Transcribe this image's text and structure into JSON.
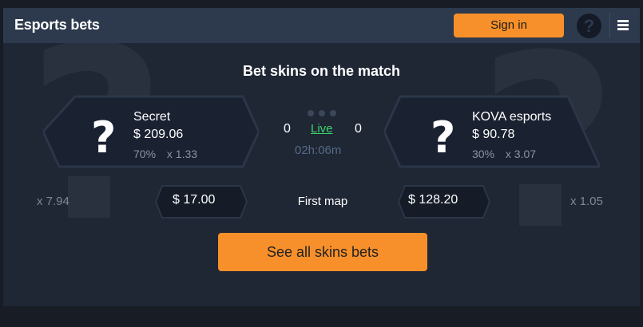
{
  "header": {
    "title": "Esports bets",
    "sign_in_label": "Sign in",
    "help_icon": "question-circle-icon",
    "menu_icon": "hamburger-menu-icon"
  },
  "headline": "Bet skins on the match",
  "match": {
    "team1": {
      "name": "Secret",
      "amount": "$ 209.06",
      "percent": "70%",
      "odds": "x 1.33"
    },
    "team2": {
      "name": "KOVA esports",
      "amount": "$ 90.78",
      "percent": "30%",
      "odds": "x 3.07"
    },
    "score1": "0",
    "score2": "0",
    "status": "Live",
    "timer": "02h:06m"
  },
  "map_bet": {
    "left_multiplier": "x 7.94",
    "left_amount": "$ 17.00",
    "label": "First map",
    "right_amount": "$ 128.20",
    "right_multiplier": "x 1.05"
  },
  "cta_label": "See all skins bets",
  "colors": {
    "accent": "#f7902a",
    "live": "#3ed36b",
    "header_bg": "#2d3a4d",
    "panel_bg": "#1f2634"
  }
}
